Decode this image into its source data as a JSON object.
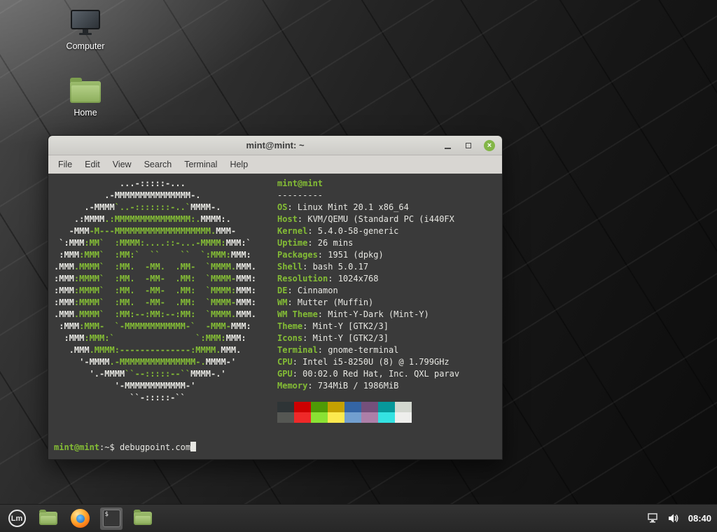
{
  "colors": {
    "terminal_bg": "#3a3a3a",
    "terminal_fg": "#e7e7e2",
    "terminal_green": "#84bd35",
    "titlebar_text": "#3c3c3c",
    "close_button": "#83b647",
    "taskbar_clock": "#ffffff"
  },
  "desktop": {
    "icons": [
      {
        "label": "Computer"
      },
      {
        "label": "Home"
      }
    ]
  },
  "window": {
    "title": "mint@mint: ~",
    "menu": [
      "File",
      "Edit",
      "View",
      "Search",
      "Terminal",
      "Help"
    ],
    "controls": {
      "close_glyph": "×"
    }
  },
  "terminal": {
    "ascii_art": [
      [
        [
          "w",
          "             ...-:::::-..."
        ]
      ],
      [
        [
          "w",
          "          .-MMMMMMMMMMMMMMM-."
        ]
      ],
      [
        [
          "w",
          "      .-MMMM"
        ],
        [
          "g",
          "`..-:::::::-..`"
        ],
        [
          "w",
          "MMMM-."
        ]
      ],
      [
        [
          "w",
          "    .:MMMM"
        ],
        [
          "g",
          ".:MMMMMMMMMMMMMMM:."
        ],
        [
          "w",
          "MMMM:."
        ]
      ],
      [
        [
          "w",
          "   -MMM"
        ],
        [
          "g",
          "-M---MMMMMMMMMMMMMMMMMMM."
        ],
        [
          "w",
          "MMM-"
        ]
      ],
      [
        [
          "w",
          " `:MMM"
        ],
        [
          "g",
          ":MM`  :MMMM:....::-...-MMMM:"
        ],
        [
          "w",
          "MMM:`"
        ]
      ],
      [
        [
          "w",
          " :MMM"
        ],
        [
          "g",
          ":MMM`  :MM:`  ``    ``  `:MMM:"
        ],
        [
          "w",
          "MMM:"
        ]
      ],
      [
        [
          "w",
          ".MMM"
        ],
        [
          "g",
          ".MMMM`  :MM.  -MM.  .MM-  `MMMM."
        ],
        [
          "w",
          "MMM."
        ]
      ],
      [
        [
          "w",
          ":MMM"
        ],
        [
          "g",
          ":MMMM`  :MM.  -MM-  .MM:  `MMMM-"
        ],
        [
          "w",
          "MMM:"
        ]
      ],
      [
        [
          "w",
          ":MMM"
        ],
        [
          "g",
          ":MMMM`  :MM.  -MM-  .MM:  `MMMM:"
        ],
        [
          "w",
          "MMM:"
        ]
      ],
      [
        [
          "w",
          ":MMM"
        ],
        [
          "g",
          ":MMMM`  :MM.  -MM-  .MM:  `MMMM-"
        ],
        [
          "w",
          "MMM:"
        ]
      ],
      [
        [
          "w",
          ".MMM"
        ],
        [
          "g",
          ".MMMM`  :MM:--:MM:--:MM:  `MMMM."
        ],
        [
          "w",
          "MMM."
        ]
      ],
      [
        [
          "w",
          " :MMM"
        ],
        [
          "g",
          ":MMM-  `-MMMMMMMMMMMM-`  -MMM-"
        ],
        [
          "w",
          "MMM:"
        ]
      ],
      [
        [
          "w",
          "  :MMM"
        ],
        [
          "g",
          ":MMM:`                `:MMM:"
        ],
        [
          "w",
          "MMM:"
        ]
      ],
      [
        [
          "w",
          "   .MMM"
        ],
        [
          "g",
          ".MMMM:--------------:MMMM."
        ],
        [
          "w",
          "MMM."
        ]
      ],
      [
        [
          "w",
          "     '-MMMM"
        ],
        [
          "g",
          ".-MMMMMMMMMMMMMMM-."
        ],
        [
          "w",
          "MMMM-'"
        ]
      ],
      [
        [
          "w",
          "       '.-MMMM"
        ],
        [
          "g",
          "``--:::::--``"
        ],
        [
          "w",
          "MMMM-.'"
        ]
      ],
      [
        [
          "w",
          "            '-MMMMMMMMMMMM-'"
        ]
      ],
      [
        [
          "w",
          "               ``-:::::-``"
        ]
      ]
    ],
    "info": {
      "user_host": "mint@mint",
      "separator": "---------",
      "entries": [
        {
          "label": "OS",
          "value": "Linux Mint 20.1 x86_64"
        },
        {
          "label": "Host",
          "value": "KVM/QEMU (Standard PC (i440FX"
        },
        {
          "label": "Kernel",
          "value": "5.4.0-58-generic"
        },
        {
          "label": "Uptime",
          "value": "26 mins"
        },
        {
          "label": "Packages",
          "value": "1951 (dpkg)"
        },
        {
          "label": "Shell",
          "value": "bash 5.0.17"
        },
        {
          "label": "Resolution",
          "value": "1024x768"
        },
        {
          "label": "DE",
          "value": "Cinnamon"
        },
        {
          "label": "WM",
          "value": "Mutter (Muffin)"
        },
        {
          "label": "WM Theme",
          "value": "Mint-Y-Dark (Mint-Y)"
        },
        {
          "label": "Theme",
          "value": "Mint-Y [GTK2/3]"
        },
        {
          "label": "Icons",
          "value": "Mint-Y [GTK2/3]"
        },
        {
          "label": "Terminal",
          "value": "gnome-terminal"
        },
        {
          "label": "CPU",
          "value": "Intel i5-8250U (8) @ 1.799GHz"
        },
        {
          "label": "GPU",
          "value": "00:02.0 Red Hat, Inc. QXL parav"
        },
        {
          "label": "Memory",
          "value": "734MiB / 1986MiB"
        }
      ]
    },
    "palette_normal": [
      "#2e3436",
      "#cc0000",
      "#4e9a06",
      "#c4a000",
      "#3465a4",
      "#75507b",
      "#06989a",
      "#d3d7cf"
    ],
    "palette_bright": [
      "#555753",
      "#ef2929",
      "#8ae234",
      "#fce94f",
      "#729fcf",
      "#ad7fa8",
      "#34e2e2",
      "#eeeeec"
    ],
    "prompt": {
      "user": "mint@mint",
      "separator": ":~$ ",
      "command": "debugpoint.com"
    }
  },
  "taskbar": {
    "menu_logo_text": "Lm",
    "terminal_icon_glyph": "$",
    "clock": "08:40"
  }
}
